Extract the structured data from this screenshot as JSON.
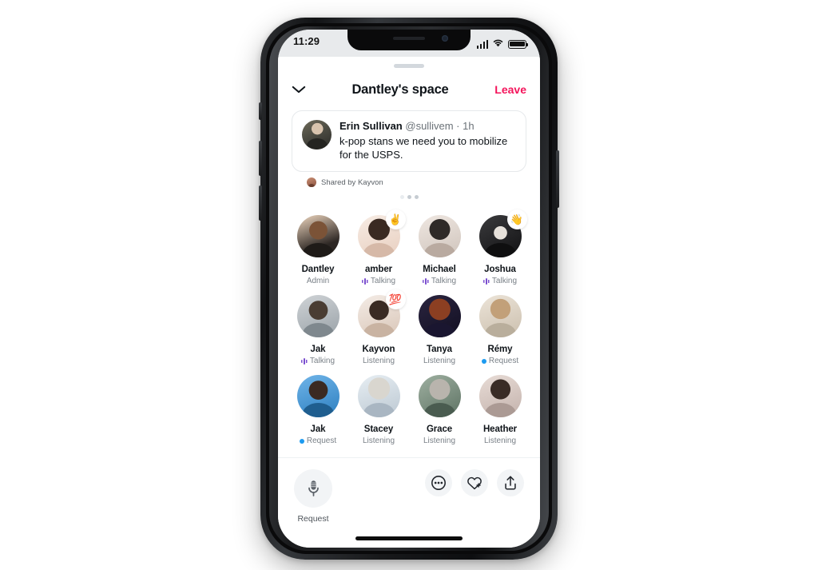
{
  "status_bar": {
    "time": "11:29",
    "signal_icon": "cellular-bars-icon",
    "wifi_icon": "wifi-icon",
    "battery_icon": "battery-full-icon"
  },
  "header": {
    "collapse_icon": "chevron-down-icon",
    "title": "Dantley's space",
    "leave_label": "Leave",
    "leave_color": "#f4145b"
  },
  "tweet_card": {
    "author_name": "Erin Sullivan",
    "author_handle": "@sullivem",
    "separator": "·",
    "timestamp": "1h",
    "text": "k-pop stans we need you to mobilize for the USPS.",
    "avatar_icon": "tweet-author-avatar"
  },
  "shared_by": {
    "avatar_icon": "sharer-avatar",
    "label": "Shared by Kayvon"
  },
  "pager": {
    "dots": [
      "off",
      "on",
      "on"
    ]
  },
  "participants": [
    {
      "name": "Dantley",
      "status": "Admin",
      "status_type": "admin",
      "badge": ""
    },
    {
      "name": "amber",
      "status": "Talking",
      "status_type": "talking",
      "badge": "✌️"
    },
    {
      "name": "Michael",
      "status": "Talking",
      "status_type": "talking",
      "badge": ""
    },
    {
      "name": "Joshua",
      "status": "Talking",
      "status_type": "talking",
      "badge": "👋"
    },
    {
      "name": "Jak",
      "status": "Talking",
      "status_type": "talking",
      "badge": ""
    },
    {
      "name": "Kayvon",
      "status": "Listening",
      "status_type": "listening",
      "badge": "💯"
    },
    {
      "name": "Tanya",
      "status": "Listening",
      "status_type": "listening",
      "badge": ""
    },
    {
      "name": "Rémy",
      "status": "Request",
      "status_type": "request",
      "badge": ""
    },
    {
      "name": "Jak",
      "status": "Request",
      "status_type": "request",
      "badge": ""
    },
    {
      "name": "Stacey",
      "status": "Listening",
      "status_type": "listening",
      "badge": ""
    },
    {
      "name": "Grace",
      "status": "Listening",
      "status_type": "listening",
      "badge": ""
    },
    {
      "name": "Heather",
      "status": "Listening",
      "status_type": "listening",
      "badge": ""
    }
  ],
  "toolbar": {
    "mic_icon": "microphone-icon",
    "mic_label": "Request",
    "more_icon": "more-dots-icon",
    "react_icon": "heart-plus-icon",
    "share_icon": "share-upload-icon"
  },
  "colors": {
    "talking_accent": "#7a4ecf",
    "request_accent": "#1d9bf0",
    "leave_accent": "#f4145b",
    "text_primary": "#0f1419",
    "text_muted": "#7a8188"
  }
}
